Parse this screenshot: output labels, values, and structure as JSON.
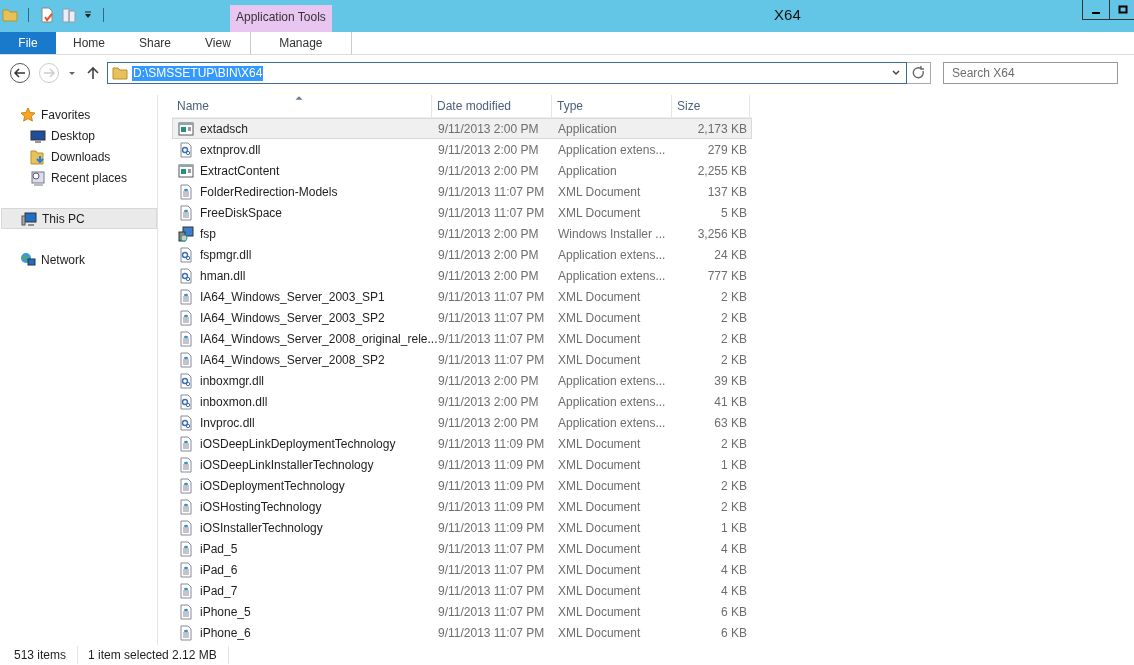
{
  "window": {
    "title": "X64"
  },
  "ribbon": {
    "context_group": "Application Tools",
    "tabs": [
      {
        "label": "File",
        "kind": "file",
        "selected": false
      },
      {
        "label": "Home",
        "kind": "tab",
        "selected": false
      },
      {
        "label": "Share",
        "kind": "tab",
        "selected": false
      },
      {
        "label": "View",
        "kind": "tab",
        "selected": false
      },
      {
        "label": "Manage",
        "kind": "context",
        "selected": false
      }
    ]
  },
  "address_bar": {
    "value": "D:\\SMSSETUP\\BIN\\X64"
  },
  "search": {
    "placeholder": "Search X64"
  },
  "sidebar": {
    "items": [
      {
        "label": "Favorites",
        "kind": "star",
        "selected": false,
        "children": [
          {
            "label": "Desktop",
            "kind": "desktop",
            "selected": false
          },
          {
            "label": "Downloads",
            "kind": "downloads",
            "selected": false
          },
          {
            "label": "Recent places",
            "kind": "recent",
            "selected": false
          }
        ]
      },
      {
        "label": "This PC",
        "kind": "pc",
        "selected": true
      },
      {
        "label": "Network",
        "kind": "network",
        "selected": false
      }
    ]
  },
  "table": {
    "columns": [
      "Name",
      "Date modified",
      "Type",
      "Size"
    ],
    "rows": [
      {
        "name": "extadsch",
        "date": "9/11/2013 2:00 PM",
        "type": "Application",
        "size": "2,173 KB",
        "kind": "app",
        "selected": true
      },
      {
        "name": "extnprov.dll",
        "date": "9/11/2013 2:00 PM",
        "type": "Application extens...",
        "size": "279 KB",
        "kind": "dll",
        "selected": false
      },
      {
        "name": "ExtractContent",
        "date": "9/11/2013 2:00 PM",
        "type": "Application",
        "size": "2,255 KB",
        "kind": "app",
        "selected": false
      },
      {
        "name": "FolderRedirection-Models",
        "date": "9/11/2013 11:07 PM",
        "type": "XML Document",
        "size": "137 KB",
        "kind": "xml",
        "selected": false
      },
      {
        "name": "FreeDiskSpace",
        "date": "9/11/2013 11:07 PM",
        "type": "XML Document",
        "size": "5 KB",
        "kind": "xml",
        "selected": false
      },
      {
        "name": "fsp",
        "date": "9/11/2013 2:00 PM",
        "type": "Windows Installer ...",
        "size": "3,256 KB",
        "kind": "msi",
        "selected": false
      },
      {
        "name": "fspmgr.dll",
        "date": "9/11/2013 2:00 PM",
        "type": "Application extens...",
        "size": "24 KB",
        "kind": "dll",
        "selected": false
      },
      {
        "name": "hman.dll",
        "date": "9/11/2013 2:00 PM",
        "type": "Application extens...",
        "size": "777 KB",
        "kind": "dll",
        "selected": false
      },
      {
        "name": "IA64_Windows_Server_2003_SP1",
        "date": "9/11/2013 11:07 PM",
        "type": "XML Document",
        "size": "2 KB",
        "kind": "xml",
        "selected": false
      },
      {
        "name": "IA64_Windows_Server_2003_SP2",
        "date": "9/11/2013 11:07 PM",
        "type": "XML Document",
        "size": "2 KB",
        "kind": "xml",
        "selected": false
      },
      {
        "name": "IA64_Windows_Server_2008_original_rele...",
        "date": "9/11/2013 11:07 PM",
        "type": "XML Document",
        "size": "2 KB",
        "kind": "xml",
        "selected": false
      },
      {
        "name": "IA64_Windows_Server_2008_SP2",
        "date": "9/11/2013 11:07 PM",
        "type": "XML Document",
        "size": "2 KB",
        "kind": "xml",
        "selected": false
      },
      {
        "name": "inboxmgr.dll",
        "date": "9/11/2013 2:00 PM",
        "type": "Application extens...",
        "size": "39 KB",
        "kind": "dll",
        "selected": false
      },
      {
        "name": "inboxmon.dll",
        "date": "9/11/2013 2:00 PM",
        "type": "Application extens...",
        "size": "41 KB",
        "kind": "dll",
        "selected": false
      },
      {
        "name": "Invproc.dll",
        "date": "9/11/2013 2:00 PM",
        "type": "Application extens...",
        "size": "63 KB",
        "kind": "dll",
        "selected": false
      },
      {
        "name": "iOSDeepLinkDeploymentTechnology",
        "date": "9/11/2013 11:09 PM",
        "type": "XML Document",
        "size": "2 KB",
        "kind": "xml",
        "selected": false
      },
      {
        "name": "iOSDeepLinkInstallerTechnology",
        "date": "9/11/2013 11:09 PM",
        "type": "XML Document",
        "size": "1 KB",
        "kind": "xml",
        "selected": false
      },
      {
        "name": "iOSDeploymentTechnology",
        "date": "9/11/2013 11:09 PM",
        "type": "XML Document",
        "size": "2 KB",
        "kind": "xml",
        "selected": false
      },
      {
        "name": "iOSHostingTechnology",
        "date": "9/11/2013 11:09 PM",
        "type": "XML Document",
        "size": "2 KB",
        "kind": "xml",
        "selected": false
      },
      {
        "name": "iOSInstallerTechnology",
        "date": "9/11/2013 11:09 PM",
        "type": "XML Document",
        "size": "1 KB",
        "kind": "xml",
        "selected": false
      },
      {
        "name": "iPad_5",
        "date": "9/11/2013 11:07 PM",
        "type": "XML Document",
        "size": "4 KB",
        "kind": "xml",
        "selected": false
      },
      {
        "name": "iPad_6",
        "date": "9/11/2013 11:07 PM",
        "type": "XML Document",
        "size": "4 KB",
        "kind": "xml",
        "selected": false
      },
      {
        "name": "iPad_7",
        "date": "9/11/2013 11:07 PM",
        "type": "XML Document",
        "size": "4 KB",
        "kind": "xml",
        "selected": false
      },
      {
        "name": "iPhone_5",
        "date": "9/11/2013 11:07 PM",
        "type": "XML Document",
        "size": "6 KB",
        "kind": "xml",
        "selected": false
      },
      {
        "name": "iPhone_6",
        "date": "9/11/2013 11:07 PM",
        "type": "XML Document",
        "size": "6 KB",
        "kind": "xml",
        "selected": false
      }
    ]
  },
  "status_bar": {
    "items": [
      "513 items",
      "1 item selected  2.12 MB"
    ]
  }
}
